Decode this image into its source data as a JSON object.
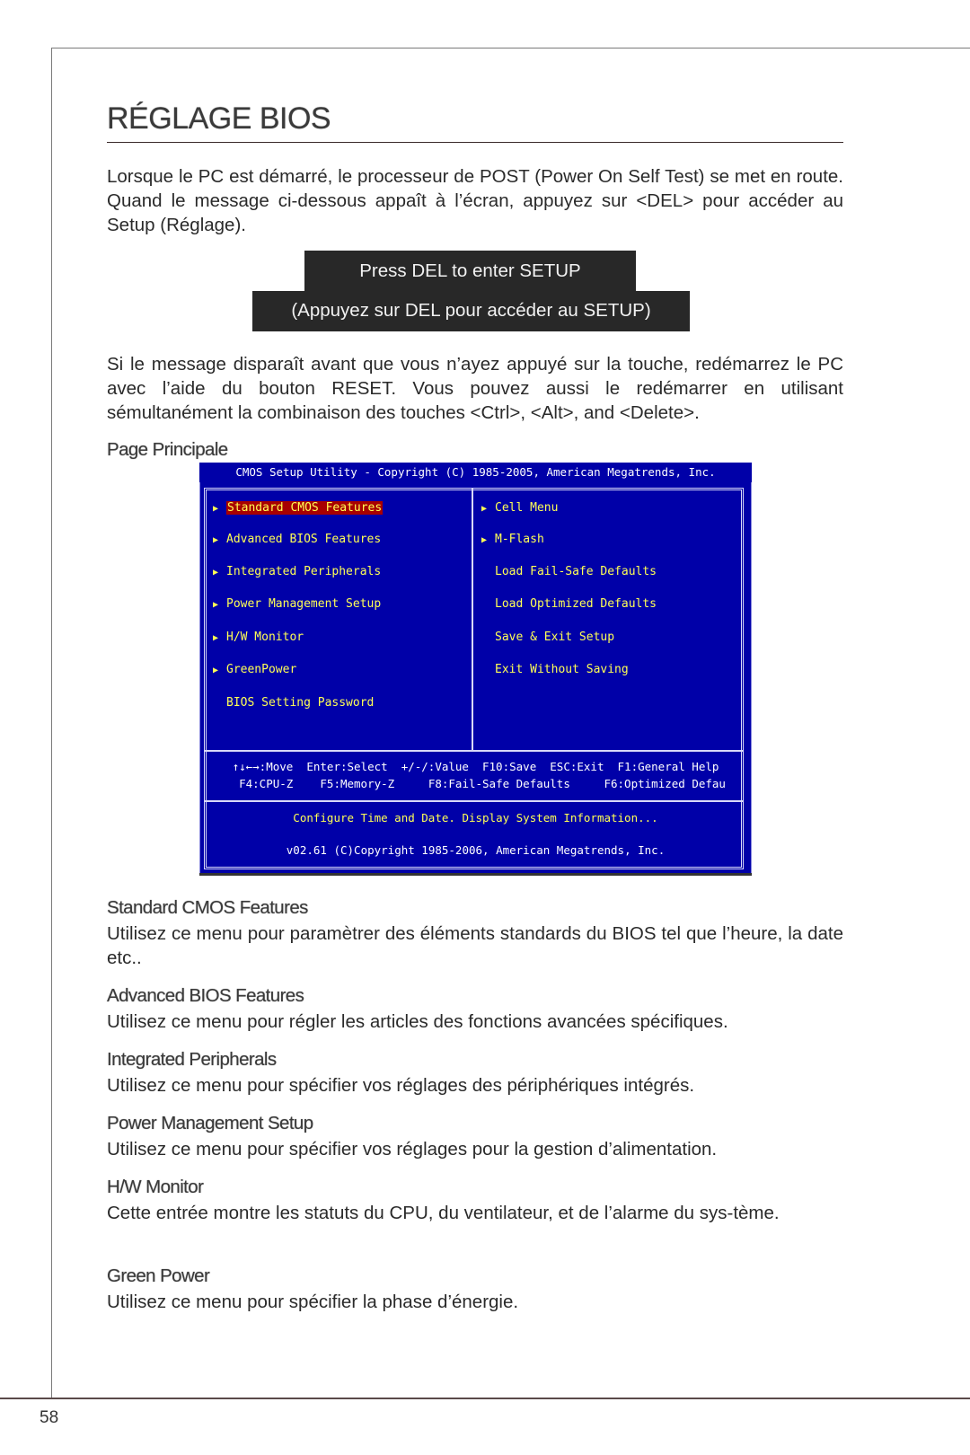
{
  "page": {
    "title": "RÉGLAGE BIOS",
    "page_number": "58"
  },
  "intro": {
    "paragraph1": "Lorsque le PC est démarré, le processeur de POST (Power On Self Test) se met en route. Quand le message ci-dessous appaît à l’écran, appuyez sur <DEL> pour accéder au Setup (Réglage).",
    "del_message": "Press DEL to enter SETUP",
    "del_message_translation": "(Appuyez sur DEL pour accéder au SETUP)",
    "paragraph2": "Si le message disparaît avant que vous n’ayez appuyé sur la touche, redémarrez le PC avec l’aide du bouton RESET. Vous pouvez aussi le redémarrer en utilisant sémultanément la combinaison des touches <Ctrl>, <Alt>, and <Delete>."
  },
  "main_page": {
    "heading": "Page Principale"
  },
  "bios": {
    "title": "CMOS Setup Utility - Copyright (C) 1985-2005, American Megatrends, Inc.",
    "arrow_glyph": "▶",
    "left_menu": [
      {
        "label": "Standard CMOS Features",
        "arrow": true,
        "selected": true
      },
      {
        "label": "Advanced BIOS Features",
        "arrow": true,
        "selected": false
      },
      {
        "label": "Integrated Peripherals",
        "arrow": true,
        "selected": false
      },
      {
        "label": "Power Management Setup",
        "arrow": true,
        "selected": false
      },
      {
        "label": "H/W Monitor",
        "arrow": true,
        "selected": false
      },
      {
        "label": "GreenPower",
        "arrow": true,
        "selected": false
      },
      {
        "label": "BIOS Setting Password",
        "arrow": false,
        "selected": false
      }
    ],
    "right_menu": [
      {
        "label": "Cell Menu",
        "arrow": true
      },
      {
        "label": "M-Flash",
        "arrow": true
      },
      {
        "label": "Load Fail-Safe Defaults",
        "arrow": false
      },
      {
        "label": "Load Optimized Defaults",
        "arrow": false
      },
      {
        "label": "Save & Exit Setup",
        "arrow": false
      },
      {
        "label": "Exit Without Saving",
        "arrow": false
      }
    ],
    "keys_line1": "↑↓←→:Move  Enter:Select  +/-/:Value  F10:Save  ESC:Exit  F1:General Help",
    "keys_line2": "  F4:CPU-Z    F5:Memory-Z     F8:Fail-Safe Defaults     F6:Optimized Defau",
    "help_text": "Configure Time and Date.  Display System Information...",
    "version": "v02.61 (C)Copyright 1985-2006, American Megatrends, Inc.",
    "colors": {
      "background": "#0000a8",
      "text": "#ffff55",
      "selected_bg": "#a80000",
      "header_text": "#ffffff"
    }
  },
  "sections": [
    {
      "heading": "Standard CMOS Features",
      "text": "Utilisez ce menu pour paramètrer des éléments standards du BIOS tel que l’heure, la date etc.."
    },
    {
      "heading": "Advanced BIOS Features",
      "text": "Utilisez ce menu pour régler les articles des fonctions avancées spécifiques."
    },
    {
      "heading": "Integrated Peripherals",
      "text": "Utilisez ce menu pour spécifier vos réglages des périphériques intégrés."
    },
    {
      "heading": "Power Management Setup",
      "text": "Utilisez ce menu pour spécifier vos réglages pour la gestion d’alimentation."
    },
    {
      "heading": "H/W Monitor",
      "text": "Cette entrée montre les statuts du CPU, du ventilateur, et de l’alarme du sys-tème."
    },
    {
      "heading": "Green Power",
      "text": "Utilisez ce menu pour spécifier la phase d’énergie."
    }
  ]
}
